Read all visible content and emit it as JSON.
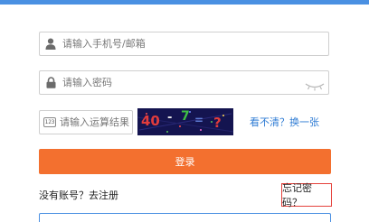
{
  "colors": {
    "accent_blue": "#4a90e2",
    "login_orange": "#f3702f",
    "link_blue": "#2f7cd4",
    "highlight_red": "#e5413b"
  },
  "phone_field": {
    "placeholder": "请输入手机号/邮箱",
    "icon": "user-icon"
  },
  "password_field": {
    "placeholder": "请输入密码",
    "icon": "lock-icon",
    "toggle_icon": "eye-closed-icon"
  },
  "captcha": {
    "badge": "123",
    "placeholder": "请输入运算结果",
    "image_chars": [
      "40",
      "-",
      "7",
      "=",
      "?"
    ],
    "refresh_label": "看不清？换一张"
  },
  "login_button": "登录",
  "register": {
    "prompt": "没有账号？",
    "link": "去注册"
  },
  "forgot_password": "忘记密码？"
}
